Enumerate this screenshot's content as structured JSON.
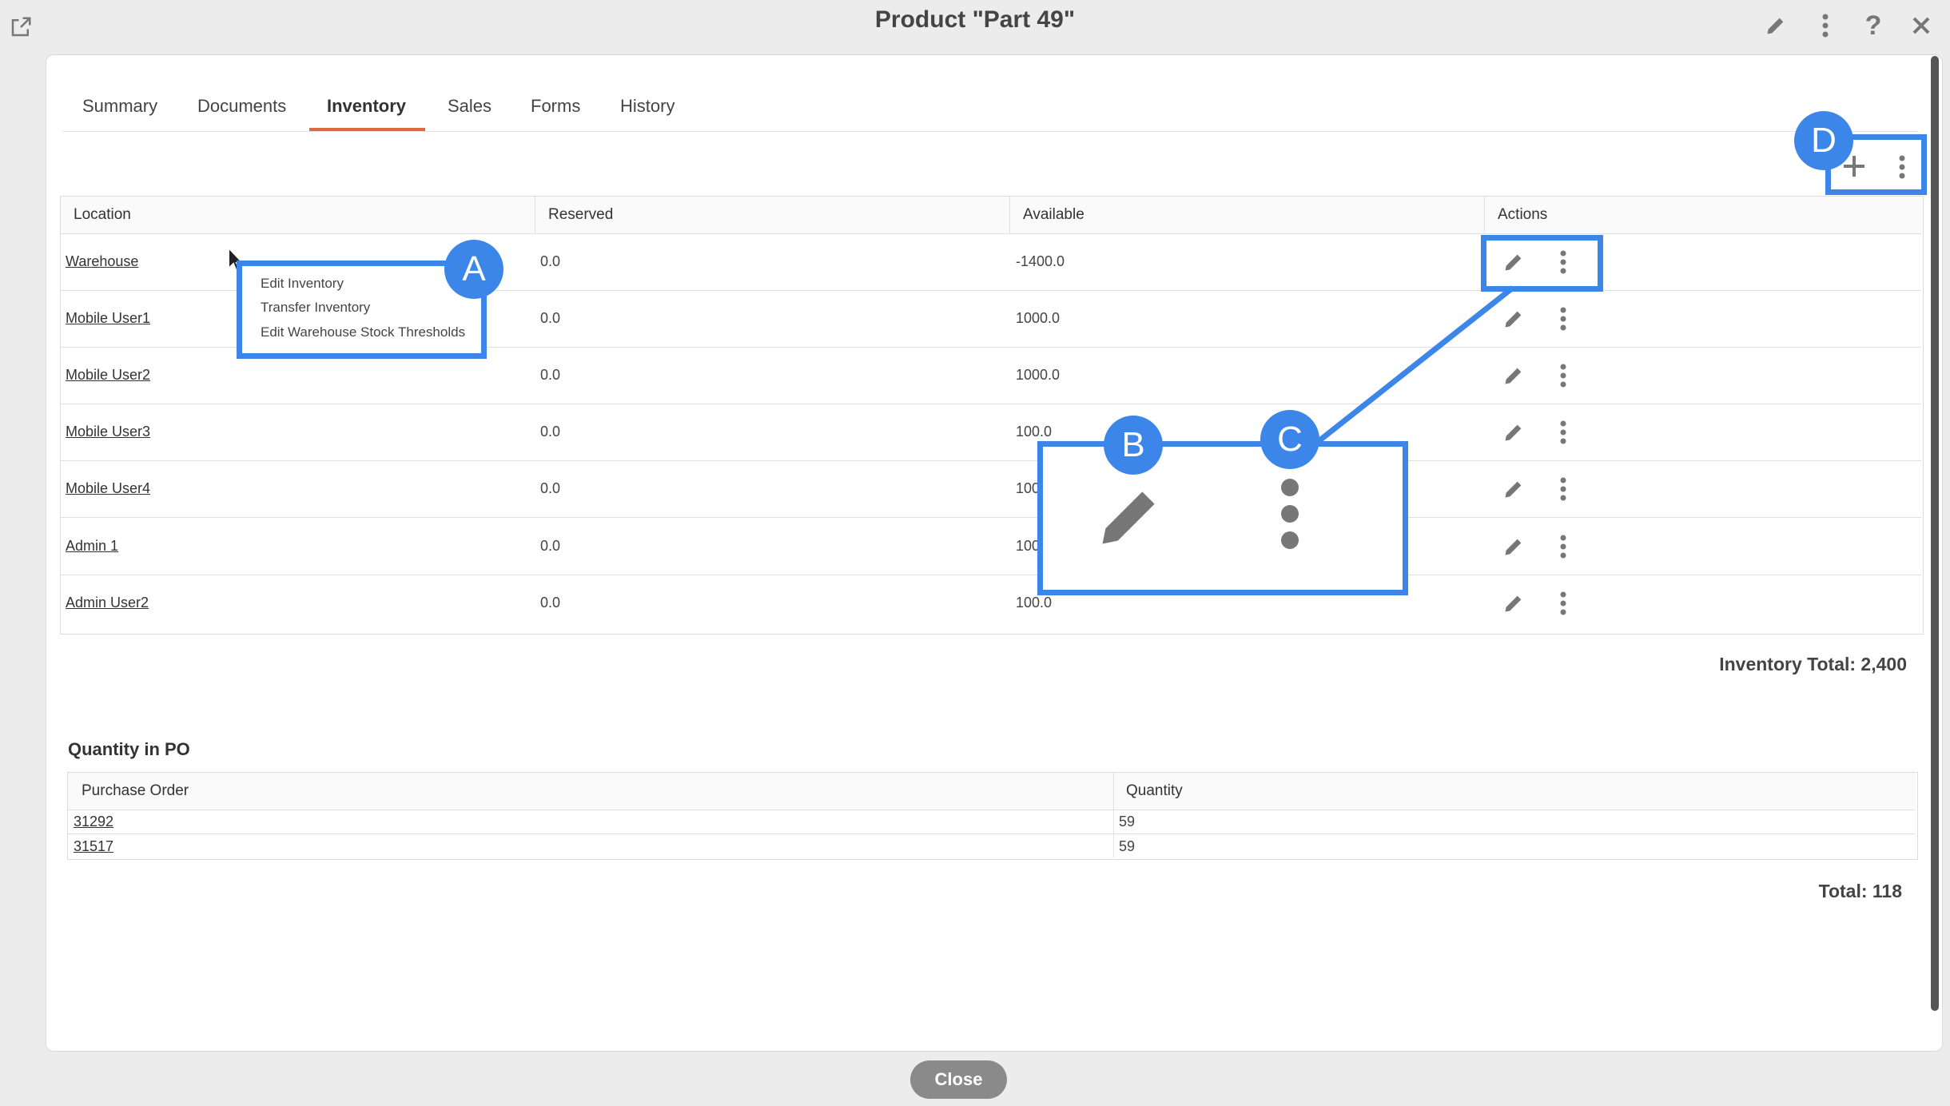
{
  "window": {
    "title": "Product \"Part 49\"",
    "icons": [
      "external-link-icon",
      "pencil-icon",
      "more-vertical-icon",
      "help-icon",
      "close-icon"
    ]
  },
  "tabs": [
    {
      "label": "Summary"
    },
    {
      "label": "Documents"
    },
    {
      "label": "Inventory",
      "active": true
    },
    {
      "label": "Sales"
    },
    {
      "label": "Forms"
    },
    {
      "label": "History"
    }
  ],
  "inventory": {
    "headers": [
      "Location",
      "Reserved",
      "Available",
      "Actions"
    ],
    "rows": [
      {
        "location": "Warehouse",
        "reserved": "0.0",
        "available": "-1400.0"
      },
      {
        "location": "Mobile User1",
        "reserved": "0.0",
        "available": "1000.0"
      },
      {
        "location": "Mobile User2",
        "reserved": "0.0",
        "available": "1000.0"
      },
      {
        "location": "Mobile User3",
        "reserved": "0.0",
        "available": "100.0"
      },
      {
        "location": "Mobile User4",
        "reserved": "0.0",
        "available": "100"
      },
      {
        "location": "Admin 1",
        "reserved": "0.0",
        "available": "100"
      },
      {
        "location": "Admin User2",
        "reserved": "0.0",
        "available": "100.0"
      }
    ],
    "total_label": "Inventory Total: 2,400"
  },
  "context_menu": {
    "items": [
      "Edit Inventory",
      "Transfer Inventory",
      "Edit Warehouse Stock Thresholds"
    ]
  },
  "po": {
    "title": "Quantity in PO",
    "headers": [
      "Purchase Order",
      "Quantity"
    ],
    "rows": [
      {
        "order": "31292",
        "quantity": "59"
      },
      {
        "order": "31517",
        "quantity": "59"
      }
    ],
    "total_label": "Total: 118"
  },
  "callouts": {
    "a": "A",
    "b": "B",
    "c": "C",
    "d": "D"
  },
  "footer": {
    "close_label": "Close"
  },
  "colors": {
    "accent": "#3b86e8",
    "tab_underline": "#e06a3b"
  }
}
